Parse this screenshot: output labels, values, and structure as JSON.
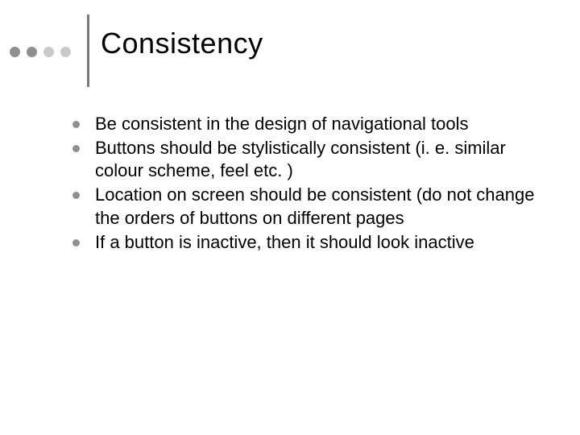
{
  "accent_dots": [
    "#8f8f8f",
    "#8f8f8f",
    "#c9c9c9",
    "#c9c9c9"
  ],
  "title": "Consistency",
  "bullets": [
    "Be consistent in the design of navigational tools",
    "Buttons should be stylistically consistent (i. e. similar colour scheme, feel etc. )",
    "Location on screen should be consistent (do not change the orders of buttons on different pages",
    "If a button is inactive, then it should look inactive"
  ]
}
